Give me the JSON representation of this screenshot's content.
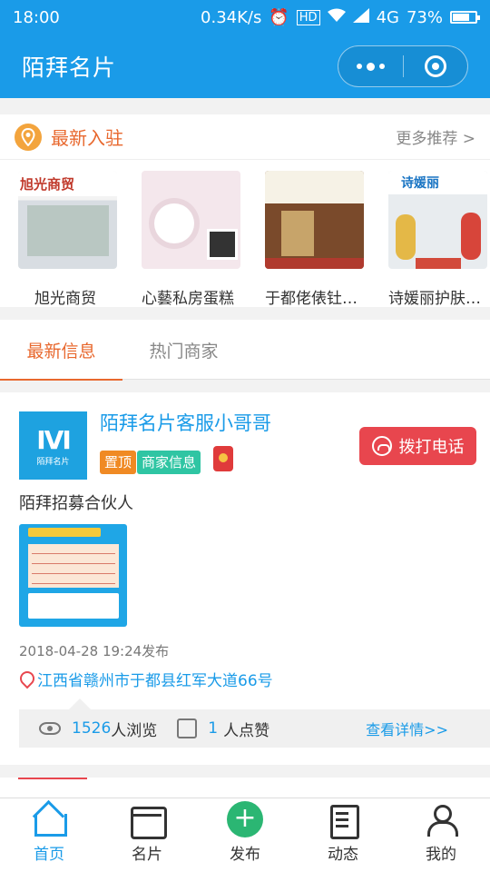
{
  "status": {
    "time": "18:00",
    "network_speed": "0.34K/s",
    "hd_badge": "HD",
    "signal": "4G",
    "battery": "73%",
    "battery_level": 0.73
  },
  "header": {
    "title": "陌拜名片"
  },
  "new_entries": {
    "title": "最新入驻",
    "more": "更多推荐 >",
    "shops": [
      {
        "name": "旭光商贸",
        "thumb_text": "旭光商贸"
      },
      {
        "name": "心藝私房蛋糕",
        "thumb_text": ""
      },
      {
        "name": "于都佬俵钍…",
        "thumb_text": ""
      },
      {
        "name": "诗媛丽护肤…",
        "thumb_text": "诗媛丽"
      }
    ]
  },
  "tabs": [
    {
      "label": "最新信息",
      "active": true
    },
    {
      "label": "热门商家",
      "active": false
    }
  ],
  "post": {
    "avatar_text": "IVI",
    "avatar_sub": "陌拜名片",
    "author": "陌拜名片客服小哥哥",
    "tags": [
      "置顶",
      "商家信息"
    ],
    "call_label": "拨打电话",
    "text": "陌拜招募合伙人",
    "time": "2018-04-28 19:24发布",
    "address": "江西省赣州市于都县红军大道66号",
    "views": "1526",
    "views_suffix": "人浏览",
    "likes": "1",
    "likes_suffix": "人点赞",
    "detail_link": "查看详情>>"
  },
  "tabbar": [
    {
      "label": "首页",
      "icon": "home-icon",
      "active": true
    },
    {
      "label": "名片",
      "icon": "card-icon",
      "active": false
    },
    {
      "label": "发布",
      "icon": "plus-icon",
      "active": false
    },
    {
      "label": "动态",
      "icon": "news-icon",
      "active": false
    },
    {
      "label": "我的",
      "icon": "user-icon",
      "active": false
    }
  ],
  "colors": {
    "primary": "#1a9be8",
    "accent": "#e8682e",
    "call": "#e8464e"
  }
}
